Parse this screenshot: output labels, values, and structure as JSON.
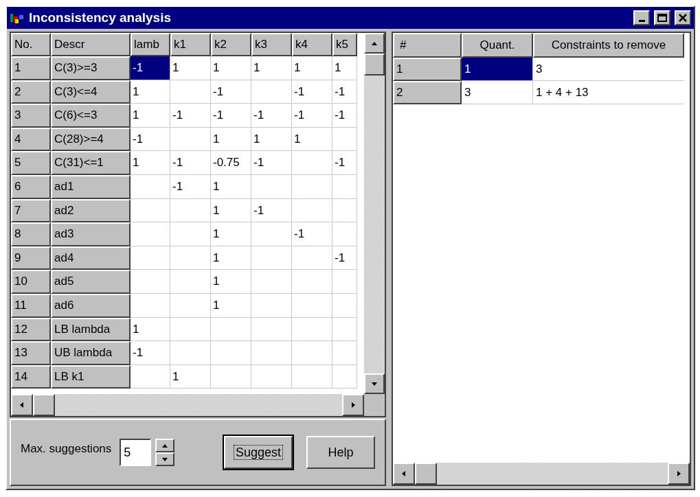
{
  "window": {
    "title": "Inconsistency analysis"
  },
  "constraints_table": {
    "columns": [
      "No.",
      "Descr",
      "lamb",
      "k1",
      "k2",
      "k3",
      "k4",
      "k5"
    ],
    "rows": [
      {
        "cells": [
          {
            "text": "1",
            "selected": false
          },
          {
            "text": "C(3)>=3",
            "selected": false
          },
          {
            "text": "-1",
            "selected": true
          },
          {
            "text": "1",
            "selected": false
          },
          {
            "text": "1",
            "selected": false
          },
          {
            "text": "1",
            "selected": false
          },
          {
            "text": "1",
            "selected": false
          },
          {
            "text": "1",
            "selected": false
          }
        ]
      },
      {
        "cells": [
          {
            "text": "2",
            "selected": false
          },
          {
            "text": "C(3)<=4",
            "selected": false
          },
          {
            "text": "1",
            "selected": false
          },
          {
            "selected": false
          },
          {
            "text": "-1",
            "selected": false
          },
          {
            "selected": false
          },
          {
            "text": "-1",
            "selected": false
          },
          {
            "text": "-1",
            "selected": false
          }
        ]
      },
      {
        "cells": [
          {
            "text": "3",
            "selected": false
          },
          {
            "text": "C(6)<=3",
            "selected": false
          },
          {
            "text": "1",
            "selected": false
          },
          {
            "text": "-1",
            "selected": false
          },
          {
            "text": "-1",
            "selected": false
          },
          {
            "text": "-1",
            "selected": false
          },
          {
            "text": "-1",
            "selected": false
          },
          {
            "text": "-1",
            "selected": false
          }
        ]
      },
      {
        "cells": [
          {
            "text": "4",
            "selected": false
          },
          {
            "text": "C(28)>=4",
            "selected": false
          },
          {
            "text": "-1",
            "selected": false
          },
          {
            "selected": false
          },
          {
            "text": "1",
            "selected": false
          },
          {
            "text": "1",
            "selected": false
          },
          {
            "text": "1",
            "selected": false
          },
          {
            "selected": false
          }
        ]
      },
      {
        "cells": [
          {
            "text": "5",
            "selected": false
          },
          {
            "text": "C(31)<=1",
            "selected": false
          },
          {
            "text": "1",
            "selected": false
          },
          {
            "text": "-1",
            "selected": false
          },
          {
            "text": "-0.75",
            "selected": false
          },
          {
            "text": "-1",
            "selected": false
          },
          {
            "selected": false
          },
          {
            "text": "-1",
            "selected": false
          }
        ]
      },
      {
        "cells": [
          {
            "text": "6",
            "selected": false
          },
          {
            "text": "ad1",
            "selected": false
          },
          {
            "selected": false
          },
          {
            "text": "-1",
            "selected": false
          },
          {
            "text": "1",
            "selected": false
          },
          {
            "selected": false
          },
          {
            "selected": false
          },
          {
            "selected": false
          }
        ]
      },
      {
        "cells": [
          {
            "text": "7",
            "selected": false
          },
          {
            "text": "ad2",
            "selected": false
          },
          {
            "selected": false
          },
          {
            "selected": false
          },
          {
            "text": "1",
            "selected": false
          },
          {
            "text": "-1",
            "selected": false
          },
          {
            "selected": false
          },
          {
            "selected": false
          }
        ]
      },
      {
        "cells": [
          {
            "text": "8",
            "selected": false
          },
          {
            "text": "ad3",
            "selected": false
          },
          {
            "selected": false
          },
          {
            "selected": false
          },
          {
            "text": "1",
            "selected": false
          },
          {
            "selected": false
          },
          {
            "text": "-1",
            "selected": false
          },
          {
            "selected": false
          }
        ]
      },
      {
        "cells": [
          {
            "text": "9",
            "selected": false
          },
          {
            "text": "ad4",
            "selected": false
          },
          {
            "selected": false
          },
          {
            "selected": false
          },
          {
            "text": "1",
            "selected": false
          },
          {
            "selected": false
          },
          {
            "selected": false
          },
          {
            "text": "-1",
            "selected": false
          }
        ]
      },
      {
        "cells": [
          {
            "text": "10",
            "selected": false
          },
          {
            "text": "ad5",
            "selected": false
          },
          {
            "selected": false
          },
          {
            "selected": false
          },
          {
            "text": "1",
            "selected": false
          },
          {
            "selected": false
          },
          {
            "selected": false
          },
          {
            "selected": false
          }
        ]
      },
      {
        "cells": [
          {
            "text": "11",
            "selected": false
          },
          {
            "text": "ad6",
            "selected": false
          },
          {
            "selected": false
          },
          {
            "selected": false
          },
          {
            "text": "1",
            "selected": false
          },
          {
            "selected": false
          },
          {
            "selected": false
          },
          {
            "selected": false
          }
        ]
      },
      {
        "cells": [
          {
            "text": "12",
            "selected": false
          },
          {
            "text": "LB lambda",
            "selected": false
          },
          {
            "text": "1",
            "selected": false
          },
          {
            "selected": false
          },
          {
            "selected": false
          },
          {
            "selected": false
          },
          {
            "selected": false
          },
          {
            "selected": false
          }
        ]
      },
      {
        "cells": [
          {
            "text": "13",
            "selected": false
          },
          {
            "text": "UB lambda",
            "selected": false
          },
          {
            "text": "-1",
            "selected": false
          },
          {
            "selected": false
          },
          {
            "selected": false
          },
          {
            "selected": false
          },
          {
            "selected": false
          },
          {
            "selected": false
          }
        ]
      },
      {
        "cells": [
          {
            "text": "14",
            "selected": false
          },
          {
            "text": "LB k1",
            "selected": false
          },
          {
            "selected": false
          },
          {
            "text": "1",
            "selected": false
          },
          {
            "selected": false
          },
          {
            "selected": false
          },
          {
            "selected": false
          },
          {
            "selected": false
          }
        ]
      }
    ]
  },
  "max_suggestions": {
    "label": "Max. suggestions",
    "value": "5"
  },
  "buttons": [
    {
      "label": "Suggest",
      "focused": true
    },
    {
      "label": "Help",
      "focused": false
    }
  ],
  "suggestions_table": {
    "columns": [
      "#",
      "Quant.",
      "Constraints to remove"
    ],
    "rows": [
      {
        "number": "1",
        "quantity": "1",
        "constraints": "3",
        "selected": true
      },
      {
        "number": "2",
        "quantity": "3",
        "constraints": "1 + 4 + 13",
        "selected": false
      }
    ]
  }
}
